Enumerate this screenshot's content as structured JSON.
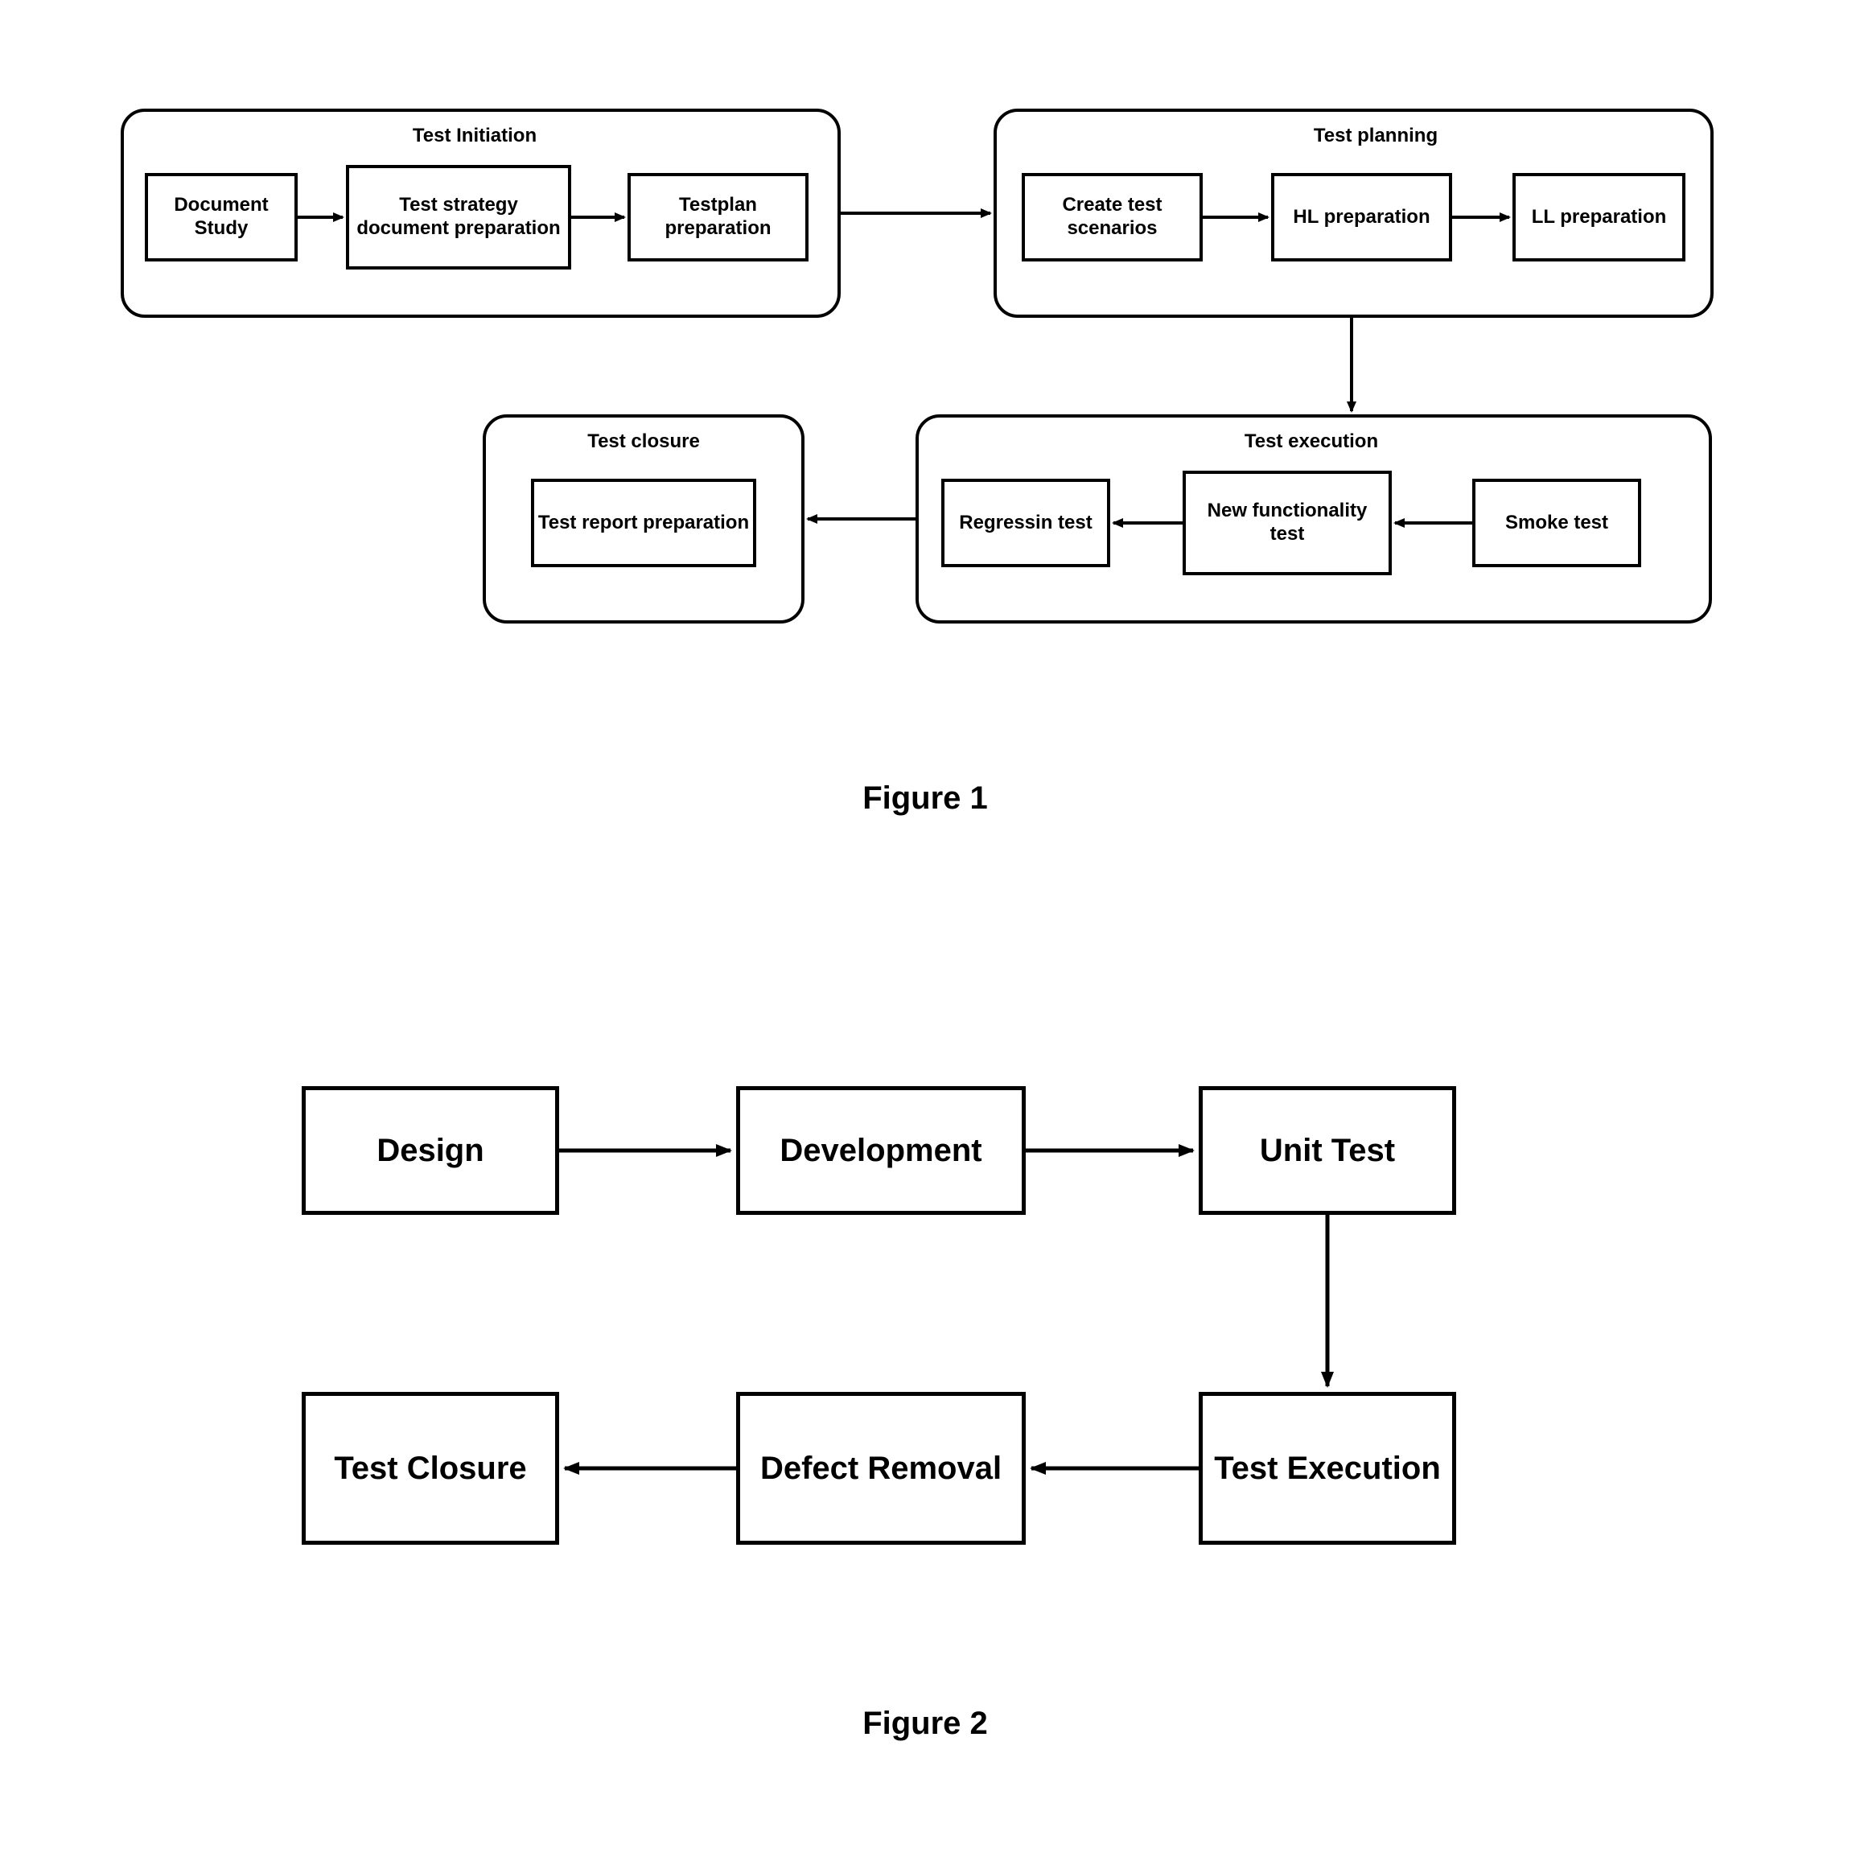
{
  "figure1": {
    "caption": "Figure 1",
    "groups": {
      "test_initiation": {
        "title": "Test Initiation",
        "boxes": {
          "document_study": "Document Study",
          "test_strategy": "Test strategy document preparation",
          "testplan": "Testplan preparation"
        }
      },
      "test_planning": {
        "title": "Test planning",
        "boxes": {
          "create_scenarios": "Create test scenarios",
          "hl_prep": "HL preparation",
          "ll_prep": "LL preparation"
        }
      },
      "test_execution": {
        "title": "Test execution",
        "boxes": {
          "regression": "Regressin test",
          "new_func": "New functionality test",
          "smoke": "Smoke test"
        }
      },
      "test_closure": {
        "title": "Test closure",
        "boxes": {
          "report": "Test report preparation"
        }
      }
    }
  },
  "figure2": {
    "caption": "Figure 2",
    "boxes": {
      "design": "Design",
      "development": "Development",
      "unit_test": "Unit Test",
      "test_execution": "Test Execution",
      "defect_removal": "Defect Removal",
      "test_closure": "Test Closure"
    }
  }
}
